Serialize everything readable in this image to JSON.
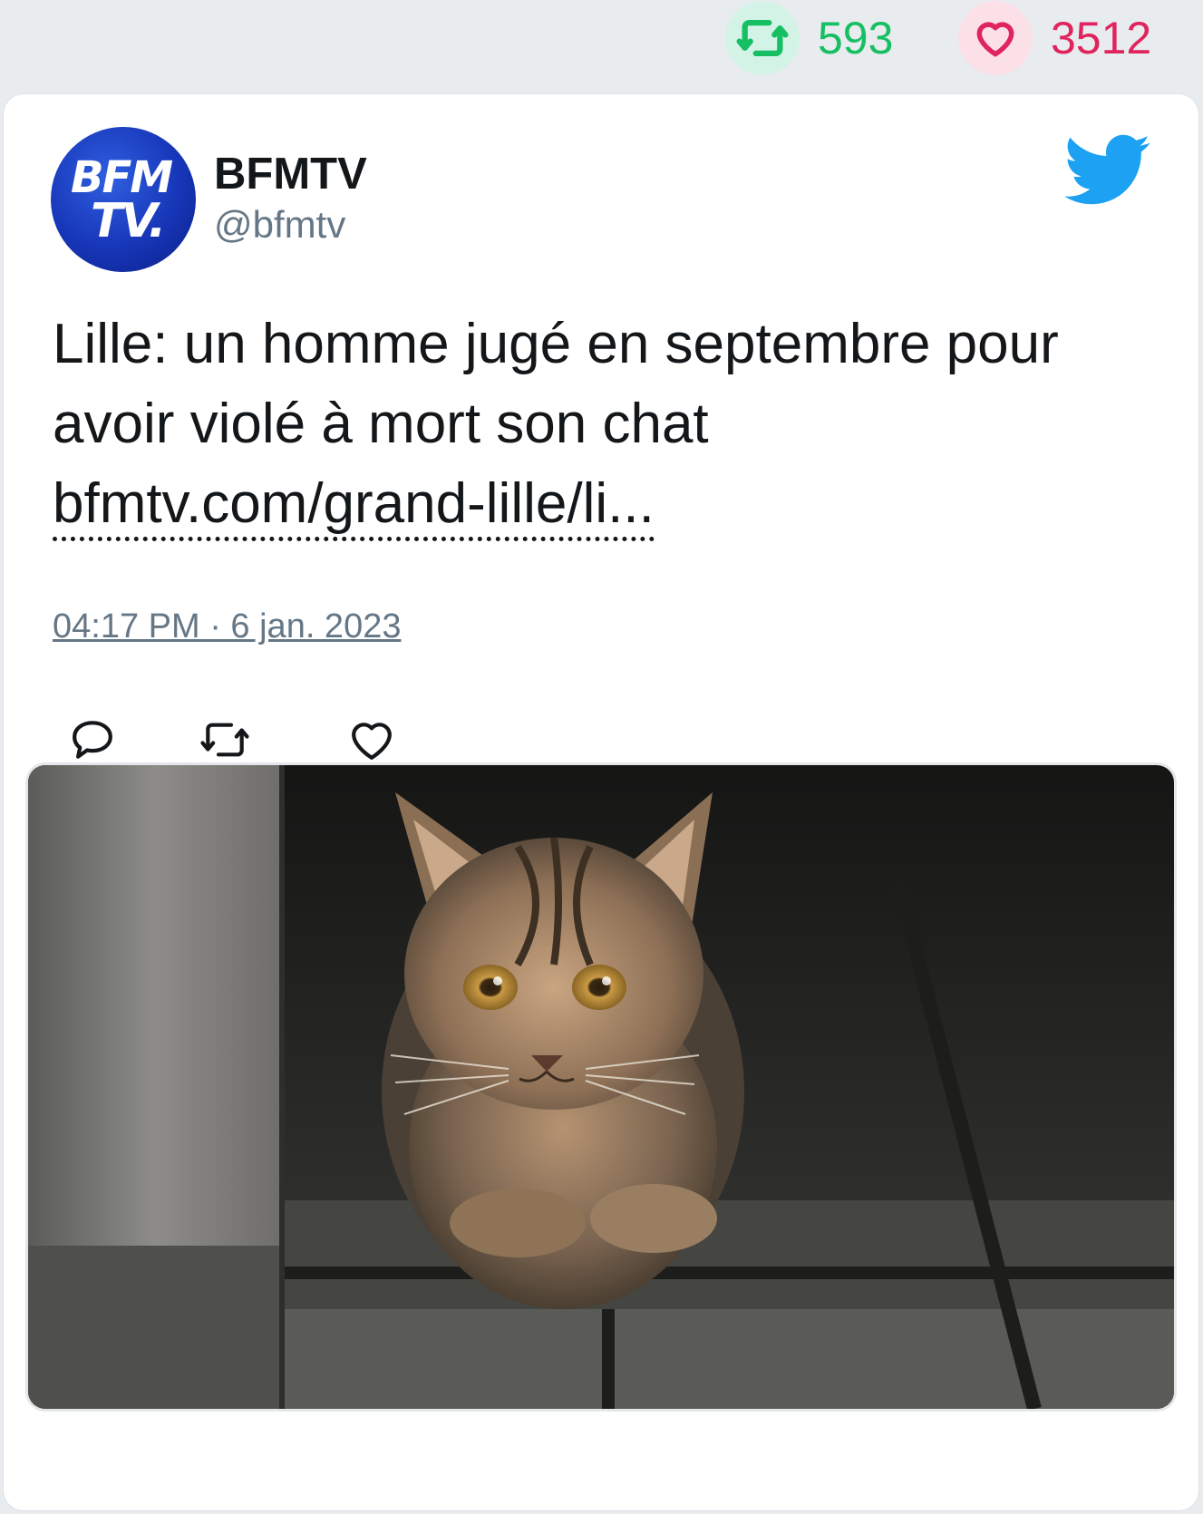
{
  "stats": {
    "retweets": "593",
    "likes": "3512",
    "retweet_icon": "retweet-icon",
    "like_icon": "heart-icon",
    "retweet_color": "#17bf63",
    "like_color": "#e0245e"
  },
  "tweet": {
    "author_name": "BFMTV",
    "author_handle": "@bfmtv",
    "avatar_text_line1": "BFM",
    "avatar_text_line2": "TV.",
    "text": "Lille: un homme jugé en septembre pour avoir violé à mort son chat",
    "link": "bfmtv.com/grand-lille/li...",
    "timestamp": "04:17 PM · 6 jan. 2023",
    "brand_icon": "twitter-bird-icon",
    "brand_color": "#1da1f2",
    "actions": [
      "reply-icon",
      "retweet-icon",
      "heart-icon"
    ],
    "photo_subject": "tabby-kitten"
  }
}
